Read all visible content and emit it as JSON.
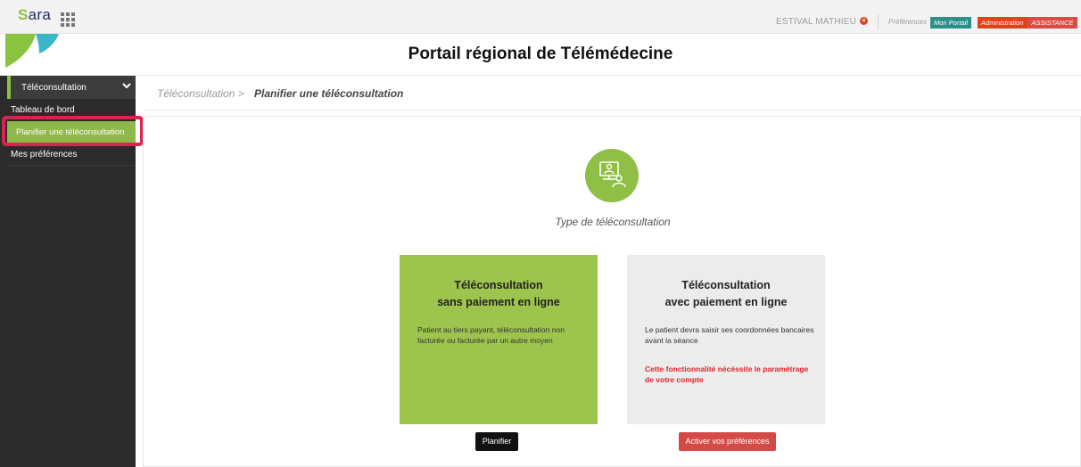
{
  "topbar": {
    "logo_text": "ara",
    "user_name": "ESTIVAL MATHIEU",
    "preferences_link": "Préférences",
    "buttons": {
      "portail": "Mon Portail",
      "admin": "Administration",
      "assistance": "ASSISTANCE"
    }
  },
  "page": {
    "title": "Portail régional de Télémédecine"
  },
  "sidebar": {
    "section_label": "Téléconsultation",
    "items": [
      {
        "label": "Tableau de bord"
      },
      {
        "label": "Planifier une téléconsultation"
      },
      {
        "label": "Mes préférences"
      }
    ]
  },
  "breadcrumb": {
    "parent": "Téléconsultation >",
    "current": "Planifier une téléconsultation"
  },
  "main": {
    "type_label": "Type de téléconsultation",
    "cards": [
      {
        "title_line1": "Téléconsultation",
        "title_line2": "sans paiement en ligne",
        "description": "Patient au tiers payant, téléconsultation non facturée ou facturée par un autre moyen",
        "button": "Planifier"
      },
      {
        "title_line1": "Téléconsultation",
        "title_line2": "avec paiement en ligne",
        "description": "Le patient devra saisir ses coordonnées bancaires avant la séance",
        "warning": "Cette fonctionnalité nécéssite le paramétrage de votre compte",
        "button": "Activer vos préférences"
      }
    ]
  },
  "colors": {
    "accent_green": "#8fb84a",
    "card_green": "#9dc54d",
    "warning_red": "#e0242a",
    "highlight": "#d8244f"
  }
}
